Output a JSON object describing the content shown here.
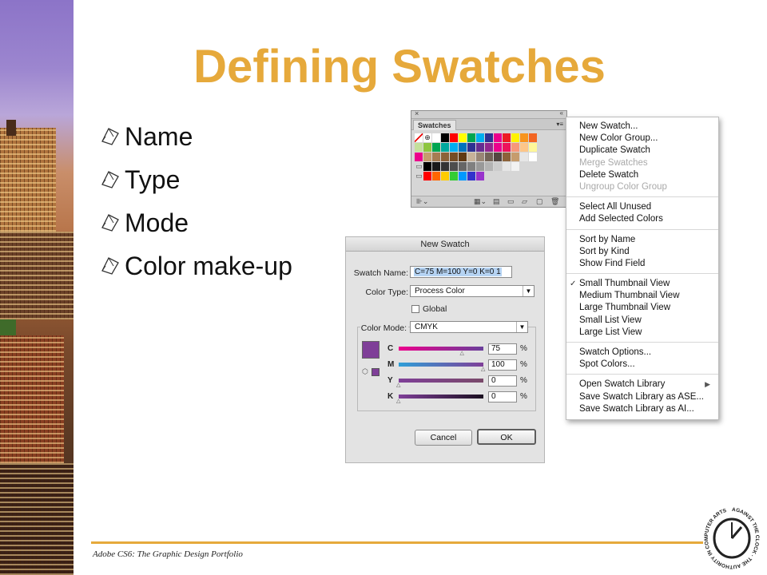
{
  "slide": {
    "title": "Defining Swatches",
    "bullets": [
      "Name",
      "Type",
      "Mode",
      "Color make-up"
    ],
    "footer": "Adobe CS6: The Graphic Design Portfolio",
    "colors": {
      "title": "#e6a93b",
      "rule": "#e6a93b"
    }
  },
  "logo": {
    "text": "AGAINST THE CLOCK · THE AUTHORITY IN COMPUTER ARTS"
  },
  "swatches_panel": {
    "tab_label": "Swatches",
    "close_glyph": "×",
    "collapse_glyph": "«",
    "menu_glyph": "▾≡",
    "rows": [
      [
        "#ffffff",
        "#ffffff",
        "#ffffff",
        "#000000",
        "#ff0000",
        "#ffff00",
        "#00a650",
        "#00aeef",
        "#2e3192",
        "#ec008c",
        "#ed1c24",
        "#fff200",
        "#f7941d",
        "#f26522"
      ],
      [
        "#c4df9b",
        "#8dc63f",
        "#00a651",
        "#00a99d",
        "#00aeef",
        "#0072bc",
        "#2e3192",
        "#662d91",
        "#92278f",
        "#ec008c",
        "#ed145b",
        "#f7977a",
        "#fdc689",
        "#fff799"
      ],
      [
        "#ec008c",
        "#c69c6d",
        "#a67c52",
        "#8c6239",
        "#754c24",
        "#603913",
        "#c7b299",
        "#998675",
        "#736357",
        "#534741",
        "#8c6239",
        "#c69c6d",
        "#e6e6e6",
        "#ffffff"
      ],
      [
        "#000000",
        "#1a1a1a",
        "#333333",
        "#4d4d4d",
        "#666666",
        "#808080",
        "#999999",
        "#b3b3b3",
        "#cccccc",
        "#e6e6e6",
        "#f2f2f2"
      ],
      [
        "#ff0000",
        "#ff6600",
        "#ffcc00",
        "#33cc33",
        "#0099ff",
        "#3333cc",
        "#9933cc"
      ]
    ]
  },
  "swatch_menu": {
    "groups": [
      [
        {
          "label": "New Swatch...",
          "enabled": true
        },
        {
          "label": "New Color Group...",
          "enabled": true
        },
        {
          "label": "Duplicate Swatch",
          "enabled": true
        },
        {
          "label": "Merge Swatches",
          "enabled": false
        },
        {
          "label": "Delete Swatch",
          "enabled": true
        },
        {
          "label": "Ungroup Color Group",
          "enabled": false
        }
      ],
      [
        {
          "label": "Select All Unused",
          "enabled": true
        },
        {
          "label": "Add Selected Colors",
          "enabled": true
        }
      ],
      [
        {
          "label": "Sort by Name",
          "enabled": true
        },
        {
          "label": "Sort by Kind",
          "enabled": true
        },
        {
          "label": "Show Find Field",
          "enabled": true
        }
      ],
      [
        {
          "label": "Small Thumbnail View",
          "enabled": true,
          "checked": true
        },
        {
          "label": "Medium Thumbnail View",
          "enabled": true
        },
        {
          "label": "Large Thumbnail View",
          "enabled": true
        },
        {
          "label": "Small List View",
          "enabled": true
        },
        {
          "label": "Large List View",
          "enabled": true
        }
      ],
      [
        {
          "label": "Swatch Options...",
          "enabled": true
        },
        {
          "label": "Spot Colors...",
          "enabled": true
        }
      ],
      [
        {
          "label": "Open Swatch Library",
          "enabled": true,
          "submenu": true
        },
        {
          "label": "Save Swatch Library as ASE...",
          "enabled": true
        },
        {
          "label": "Save Swatch Library as AI...",
          "enabled": true
        }
      ]
    ],
    "check_glyph": "✓",
    "submenu_glyph": "▶"
  },
  "new_swatch_dialog": {
    "title": "New Swatch",
    "swatch_name_label": "Swatch Name:",
    "swatch_name_value": "C=75 M=100 Y=0 K=0 1",
    "color_type_label": "Color Type:",
    "color_type_value": "Process Color",
    "global_label": "Global",
    "color_mode_label": "Color Mode:",
    "color_mode_value": "CMYK",
    "swatch_color": "#7f3f98",
    "channels": [
      {
        "name": "C",
        "value": "75",
        "unit": "%",
        "level": 0.75
      },
      {
        "name": "M",
        "value": "100",
        "unit": "%",
        "level": 1.0
      },
      {
        "name": "Y",
        "value": "0",
        "unit": "%",
        "level": 0.0
      },
      {
        "name": "K",
        "value": "0",
        "unit": "%",
        "level": 0.0
      }
    ],
    "cancel_label": "Cancel",
    "ok_label": "OK"
  }
}
